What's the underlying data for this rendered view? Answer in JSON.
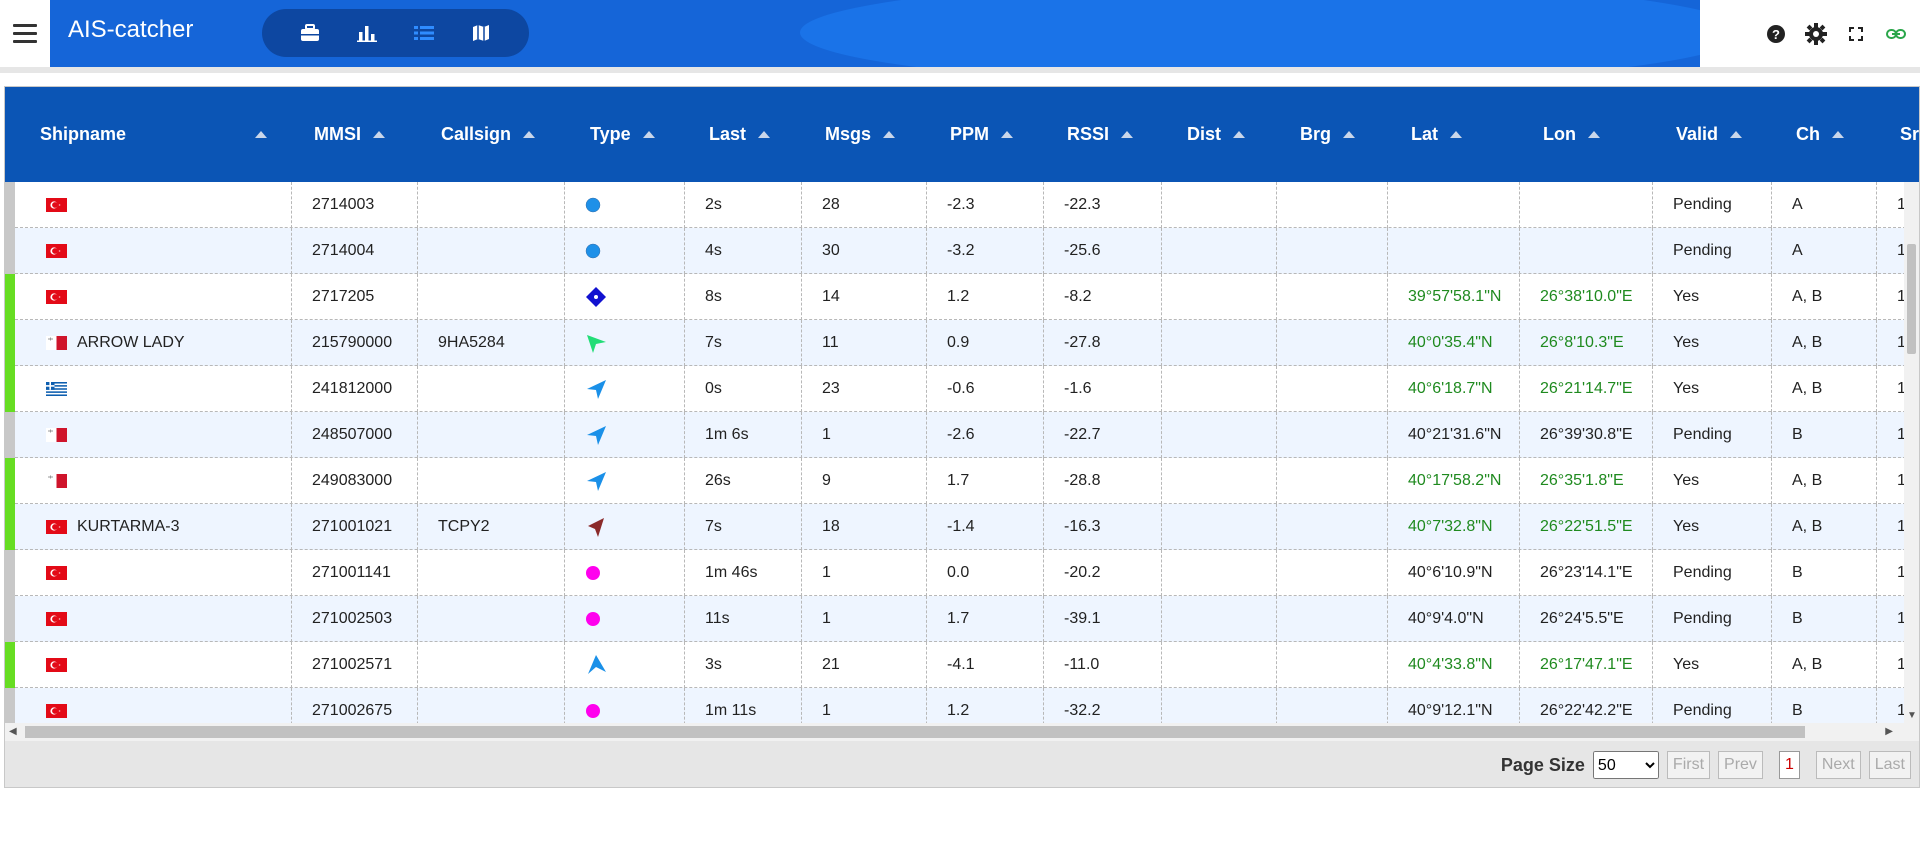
{
  "header": {
    "title": "AIS-catcher",
    "nav": [
      {
        "icon": "briefcase-icon",
        "name": "nav-dashboard"
      },
      {
        "icon": "bar-chart-icon",
        "name": "nav-statistics"
      },
      {
        "icon": "list-icon",
        "name": "nav-ships",
        "active": true
      },
      {
        "icon": "map-icon",
        "name": "nav-map"
      }
    ],
    "right_icons": [
      "help-icon",
      "gear-icon",
      "fullscreen-icon",
      "link-icon"
    ]
  },
  "colors": {
    "header_blue": "#1565d8",
    "table_header": "#0b55b5",
    "coord_green": "#1f8a1f",
    "stripe_green": "#66dd22",
    "stripe_gray": "#c8c8c8"
  },
  "table": {
    "columns": [
      "Shipname",
      "MMSI",
      "Callsign",
      "Type",
      "Last",
      "Msgs",
      "PPM",
      "RSSI",
      "Dist",
      "Brg",
      "Lat",
      "Lon",
      "Valid",
      "Ch",
      "Src"
    ],
    "rows": [
      {
        "flag": "tr",
        "shipname": "",
        "mmsi": "2714003",
        "callsign": "",
        "type": "circle-blue",
        "last": "2s",
        "msgs": "28",
        "ppm": "-2.3",
        "rssi": "-22.3",
        "dist": "",
        "brg": "",
        "lat": "",
        "lon": "",
        "valid": "Pending",
        "ch": "A",
        "src": "1",
        "stripe": "gray",
        "green": false
      },
      {
        "flag": "tr",
        "shipname": "",
        "mmsi": "2714004",
        "callsign": "",
        "type": "circle-blue",
        "last": "4s",
        "msgs": "30",
        "ppm": "-3.2",
        "rssi": "-25.6",
        "dist": "",
        "brg": "",
        "lat": "",
        "lon": "",
        "valid": "Pending",
        "ch": "A",
        "src": "1",
        "stripe": "gray",
        "green": false
      },
      {
        "flag": "tr",
        "shipname": "",
        "mmsi": "2717205",
        "callsign": "",
        "type": "diamond-blue",
        "last": "8s",
        "msgs": "14",
        "ppm": "1.2",
        "rssi": "-8.2",
        "dist": "",
        "brg": "",
        "lat": "39°57'58.1\"N",
        "lon": "26°38'10.0\"E",
        "valid": "Yes",
        "ch": "A, B",
        "src": "1",
        "stripe": "green",
        "green": true
      },
      {
        "flag": "mt",
        "shipname": "ARROW LADY",
        "mmsi": "215790000",
        "callsign": "9HA5284",
        "type": "arrow-green",
        "last": "7s",
        "msgs": "11",
        "ppm": "0.9",
        "rssi": "-27.8",
        "dist": "",
        "brg": "",
        "lat": "40°0'35.4\"N",
        "lon": "26°8'10.3\"E",
        "valid": "Yes",
        "ch": "A, B",
        "src": "1",
        "stripe": "green",
        "green": true
      },
      {
        "flag": "gr",
        "shipname": "",
        "mmsi": "241812000",
        "callsign": "",
        "type": "arrow-blue",
        "last": "0s",
        "msgs": "23",
        "ppm": "-0.6",
        "rssi": "-1.6",
        "dist": "",
        "brg": "",
        "lat": "40°6'18.7\"N",
        "lon": "26°21'14.7\"E",
        "valid": "Yes",
        "ch": "A, B",
        "src": "1",
        "stripe": "green",
        "green": true
      },
      {
        "flag": "mt",
        "shipname": "",
        "mmsi": "248507000",
        "callsign": "",
        "type": "arrow-blue",
        "last": "1m 6s",
        "msgs": "1",
        "ppm": "-2.6",
        "rssi": "-22.7",
        "dist": "",
        "brg": "",
        "lat": "40°21'31.6\"N",
        "lon": "26°39'30.8\"E",
        "valid": "Pending",
        "ch": "B",
        "src": "1",
        "stripe": "gray",
        "green": false
      },
      {
        "flag": "mt",
        "shipname": "",
        "mmsi": "249083000",
        "callsign": "",
        "type": "arrow-blue",
        "last": "26s",
        "msgs": "9",
        "ppm": "1.7",
        "rssi": "-28.8",
        "dist": "",
        "brg": "",
        "lat": "40°17'58.2\"N",
        "lon": "26°35'1.8\"E",
        "valid": "Yes",
        "ch": "A, B",
        "src": "1",
        "stripe": "green",
        "green": true
      },
      {
        "flag": "tr",
        "shipname": "KURTARMA-3",
        "mmsi": "271001021",
        "callsign": "TCPY2",
        "type": "arrow-brown",
        "last": "7s",
        "msgs": "18",
        "ppm": "-1.4",
        "rssi": "-16.3",
        "dist": "",
        "brg": "",
        "lat": "40°7'32.8\"N",
        "lon": "26°22'51.5\"E",
        "valid": "Yes",
        "ch": "A, B",
        "src": "1",
        "stripe": "green",
        "green": true
      },
      {
        "flag": "tr",
        "shipname": "",
        "mmsi": "271001141",
        "callsign": "",
        "type": "circle-magenta",
        "last": "1m 46s",
        "msgs": "1",
        "ppm": "0.0",
        "rssi": "-20.2",
        "dist": "",
        "brg": "",
        "lat": "40°6'10.9\"N",
        "lon": "26°23'14.1\"E",
        "valid": "Pending",
        "ch": "B",
        "src": "1",
        "stripe": "gray",
        "green": false
      },
      {
        "flag": "tr",
        "shipname": "",
        "mmsi": "271002503",
        "callsign": "",
        "type": "circle-magenta",
        "last": "11s",
        "msgs": "1",
        "ppm": "1.7",
        "rssi": "-39.1",
        "dist": "",
        "brg": "",
        "lat": "40°9'4.0\"N",
        "lon": "26°24'5.5\"E",
        "valid": "Pending",
        "ch": "B",
        "src": "1",
        "stripe": "gray",
        "green": false
      },
      {
        "flag": "tr",
        "shipname": "",
        "mmsi": "271002571",
        "callsign": "",
        "type": "arrow-blue-up",
        "last": "3s",
        "msgs": "21",
        "ppm": "-4.1",
        "rssi": "-11.0",
        "dist": "",
        "brg": "",
        "lat": "40°4'33.8\"N",
        "lon": "26°17'47.1\"E",
        "valid": "Yes",
        "ch": "A, B",
        "src": "1",
        "stripe": "green",
        "green": true
      },
      {
        "flag": "tr",
        "shipname": "",
        "mmsi": "271002675",
        "callsign": "",
        "type": "circle-magenta",
        "last": "1m 11s",
        "msgs": "1",
        "ppm": "1.2",
        "rssi": "-32.2",
        "dist": "",
        "brg": "",
        "lat": "40°9'12.1\"N",
        "lon": "26°22'42.2\"E",
        "valid": "Pending",
        "ch": "B",
        "src": "1",
        "stripe": "gray",
        "green": false
      }
    ]
  },
  "footer": {
    "page_size_label": "Page Size",
    "page_size_value": "50",
    "first": "First",
    "prev": "Prev",
    "current_page": "1",
    "next": "Next",
    "last": "Last"
  }
}
